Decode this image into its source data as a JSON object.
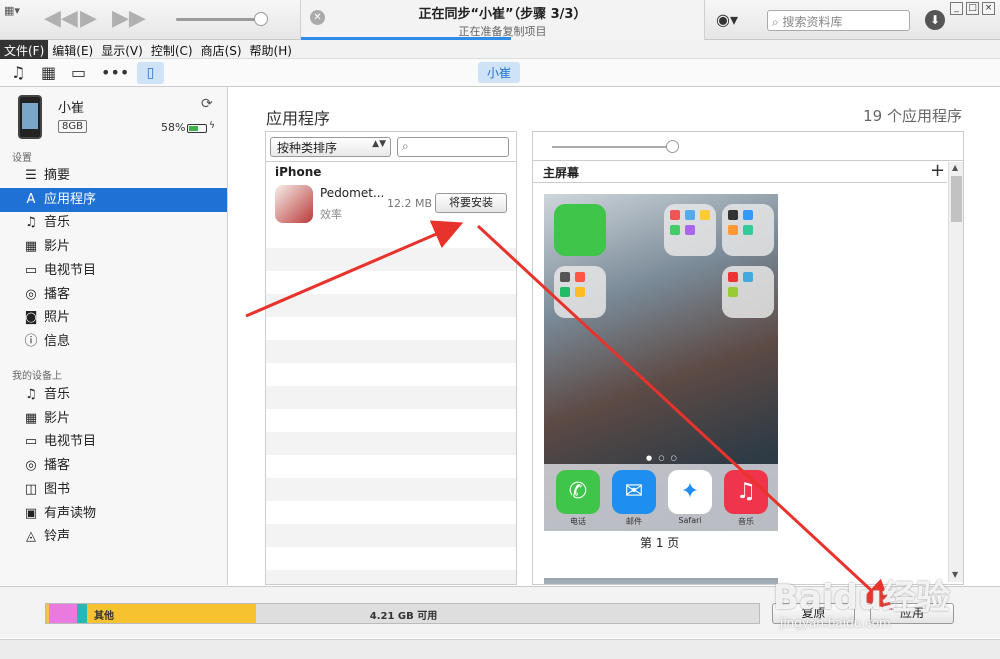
{
  "titlebar": {
    "now_syncing": "正在同步“小崔”（步骤 3/3）",
    "sync_status": "正在准备复制项目",
    "sync_progress": 0.52,
    "search_placeholder": "搜索资料库"
  },
  "menu": [
    "文件(F)",
    "编辑(E)",
    "显示(V)",
    "控制(C)",
    "商店(S)",
    "帮助(H)"
  ],
  "toolbar": {
    "device_name": "小崔"
  },
  "device": {
    "name": "小崔",
    "capacity": "8GB",
    "battery": "58%",
    "battery_level": 0.58
  },
  "sidebar": {
    "settings_title": "设置",
    "settings_items": [
      {
        "label": "摘要",
        "icon": "summary-icon",
        "glyph": "☰"
      },
      {
        "label": "应用程序",
        "icon": "apps-icon",
        "glyph": "A"
      },
      {
        "label": "音乐",
        "icon": "music-icon",
        "glyph": "♫"
      },
      {
        "label": "影片",
        "icon": "film-icon",
        "glyph": "▦"
      },
      {
        "label": "电视节目",
        "icon": "tv-icon",
        "glyph": "▭"
      },
      {
        "label": "播客",
        "icon": "podcast-icon",
        "glyph": "◎"
      },
      {
        "label": "照片",
        "icon": "camera-icon",
        "glyph": "◙"
      },
      {
        "label": "信息",
        "icon": "info-icon",
        "glyph": "ⓘ"
      }
    ],
    "ondevice_title": "我的设备上",
    "ondevice_items": [
      {
        "label": "音乐",
        "icon": "music-icon",
        "glyph": "♫"
      },
      {
        "label": "影片",
        "icon": "film-icon",
        "glyph": "▦"
      },
      {
        "label": "电视节目",
        "icon": "tv-icon",
        "glyph": "▭"
      },
      {
        "label": "播客",
        "icon": "podcast-icon",
        "glyph": "◎"
      },
      {
        "label": "图书",
        "icon": "book-icon",
        "glyph": "◫"
      },
      {
        "label": "有声读物",
        "icon": "audiobook-icon",
        "glyph": "▣"
      },
      {
        "label": "铃声",
        "icon": "bell-icon",
        "glyph": "◬"
      }
    ]
  },
  "main": {
    "title": "应用程序",
    "count": "19 个应用程序",
    "sort_label": "按种类排序",
    "list_group": "iPhone",
    "app": {
      "name": "Pedomet...",
      "category": "效率",
      "size": "12.2 MB",
      "action": "将要安装"
    },
    "home_title": "主屏幕",
    "dock": [
      {
        "label": "电话",
        "color": "#3fc64a",
        "glyph": "✆"
      },
      {
        "label": "邮件",
        "color": "#1e8ff0",
        "glyph": "✉"
      },
      {
        "label": "Safari",
        "color": "#ffffff",
        "glyph": "✦"
      },
      {
        "label": "音乐",
        "color": "#f0344b",
        "glyph": "♫"
      }
    ],
    "page_label": "第 1 页"
  },
  "bottom": {
    "other_label": "其他",
    "free_label": "4.21 GB 可用",
    "restore": "复原",
    "apply": "应用"
  },
  "colors": {
    "accent": "#1f71d6",
    "arrow": "#e8322c"
  },
  "watermark": {
    "logo": "Baidu经验",
    "url": "jingyan.baidu.com"
  }
}
